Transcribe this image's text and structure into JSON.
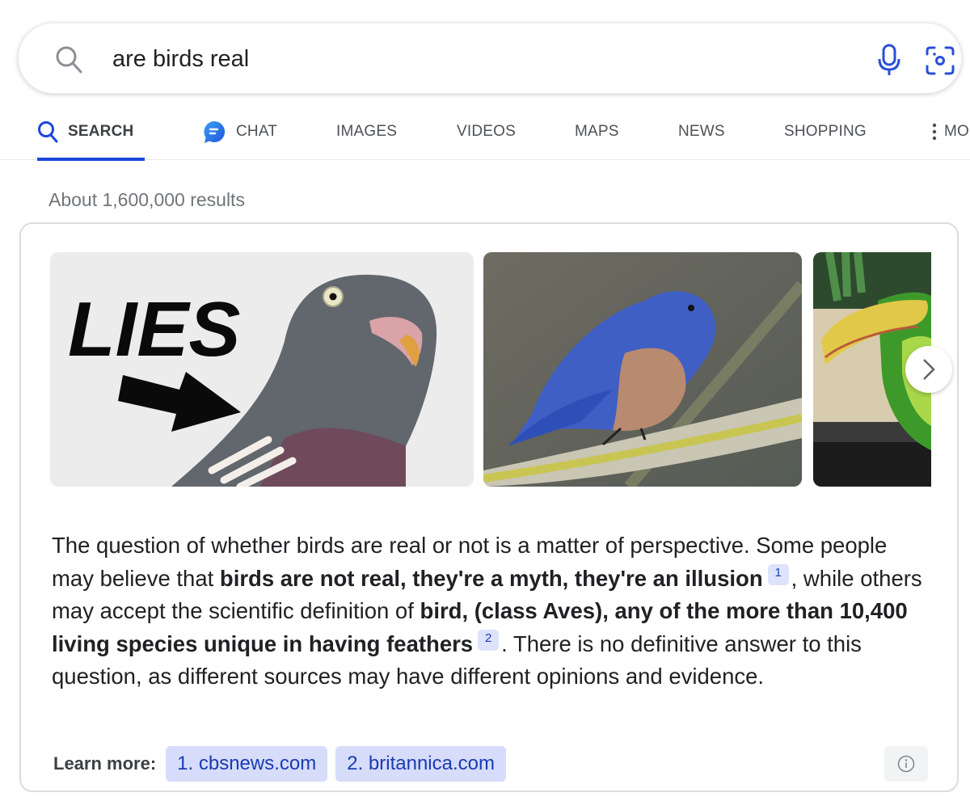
{
  "search": {
    "query": "are birds real",
    "icons": {
      "search": "search-icon",
      "voice": "microphone-icon",
      "lens": "camera-lens-icon"
    }
  },
  "tabs": [
    {
      "label": "SEARCH",
      "icon": "search-icon",
      "active": true
    },
    {
      "label": "CHAT",
      "icon": "chat-bubble-icon",
      "active": false
    },
    {
      "label": "IMAGES",
      "active": false
    },
    {
      "label": "VIDEOS",
      "active": false
    },
    {
      "label": "MAPS",
      "active": false
    },
    {
      "label": "NEWS",
      "active": false
    },
    {
      "label": "SHOPPING",
      "active": false
    },
    {
      "label": "MORE",
      "icon": "more-vertical-icon",
      "active": false
    }
  ],
  "results_count": "About 1,600,000 results",
  "card": {
    "images": [
      {
        "name": "pigeon-lies-image",
        "overlay_text": "LIES"
      },
      {
        "name": "bluebird-image"
      },
      {
        "name": "toucan-image"
      }
    ],
    "answer": {
      "p1": "The question of whether birds are real or not is a matter of perspective. Some people may believe that ",
      "b1": "birds are not real, they're a myth, they're an illusion",
      "c1": "1",
      "p2": ", while others may accept the scientific definition of ",
      "b2": "bird, (class Aves), any of the more than 10,400 living species unique in having feathers",
      "c2": "2",
      "p3": ". There is no definitive answer to this question, as different sources may have different opinions and evidence."
    },
    "learn_more": {
      "label": "Learn more:",
      "links": [
        "1. cbsnews.com",
        "2. britannica.com"
      ]
    }
  },
  "colors": {
    "accent": "#1a47d8",
    "chip_bg": "#d6dcf9",
    "chip_text": "#1a3bb3",
    "muted_text": "#70757a"
  }
}
